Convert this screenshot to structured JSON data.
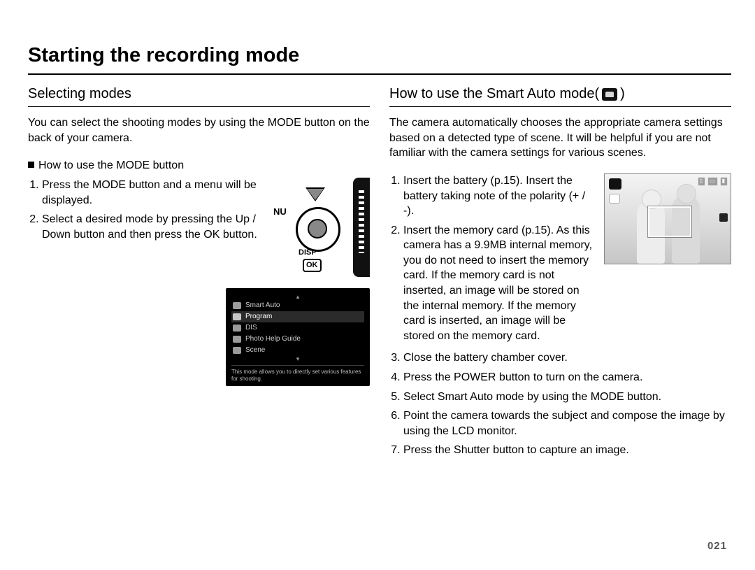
{
  "page": {
    "title": "Starting the recording mode",
    "number": "021"
  },
  "left": {
    "heading": "Selecting modes",
    "intro": "You can select the shooting modes by using the MODE button on the back of your camera.",
    "sub_heading": "How to use the MODE button",
    "steps": [
      "Press the MODE button and a menu will be displayed.",
      "Select a desired mode by pressing the Up / Down button and then press the OK button."
    ],
    "sketch_labels": {
      "nu": "NU",
      "disp": "DISP",
      "ok": "OK"
    },
    "menu": {
      "items": [
        "Smart Auto",
        "Program",
        "DIS",
        "Photo Help Guide",
        "Scene"
      ],
      "selected_index": 1,
      "hint": "This mode allows you to directly set various features for shooting."
    }
  },
  "right": {
    "heading_prefix": "How to use the Smart Auto mode(",
    "heading_suffix": " )",
    "intro": "The camera automatically chooses the appropriate camera settings based on a detected type of scene. It will be helpful if you are not familiar with the camera settings for various scenes.",
    "steps": [
      "Insert the battery (p.15). Insert the battery taking note of the polarity (+ / -).",
      "Insert the memory card (p.15). As this camera has a 9.9MB internal memory, you do not need to insert the memory card. If the memory card is not inserted, an image will be stored on the internal memory. If the memory card is inserted, an image will be stored on the memory card.",
      "Close the battery chamber cover.",
      "Press the POWER button to turn on the camera.",
      "Select Smart Auto mode by using the MODE button.",
      "Point the camera towards the subject and compose the image by using the LCD monitor.",
      "Press the Shutter button to capture an image."
    ]
  }
}
